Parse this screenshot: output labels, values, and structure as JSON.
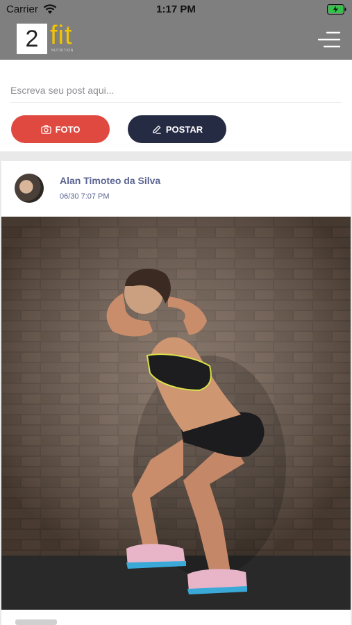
{
  "status_bar": {
    "carrier": "Carrier",
    "time": "1:17 PM",
    "wifi_icon": "wifi-icon",
    "battery_icon": "battery-charging-icon"
  },
  "nav": {
    "logo_number": "2",
    "logo_text": "fit",
    "logo_tagline": "NUTRITION",
    "menu_icon": "hamburger-menu-icon",
    "background": "#7f7f80",
    "logo_accent": "#f2c400"
  },
  "composer": {
    "placeholder": "Escreva seu post aqui...",
    "value": "",
    "photo_button": "FOTO",
    "photo_icon": "camera-icon",
    "post_button": "POSTAR",
    "post_icon": "pencil-icon",
    "photo_color": "#e0493f",
    "post_color": "#262b44"
  },
  "feed": {
    "posts": [
      {
        "author": "Alan Timoteo da Silva",
        "date": "06/30 7:07 PM",
        "image_alt": "Woman doing a squat exercise in front of a brick wall",
        "name_color": "#5a6391"
      }
    ]
  }
}
